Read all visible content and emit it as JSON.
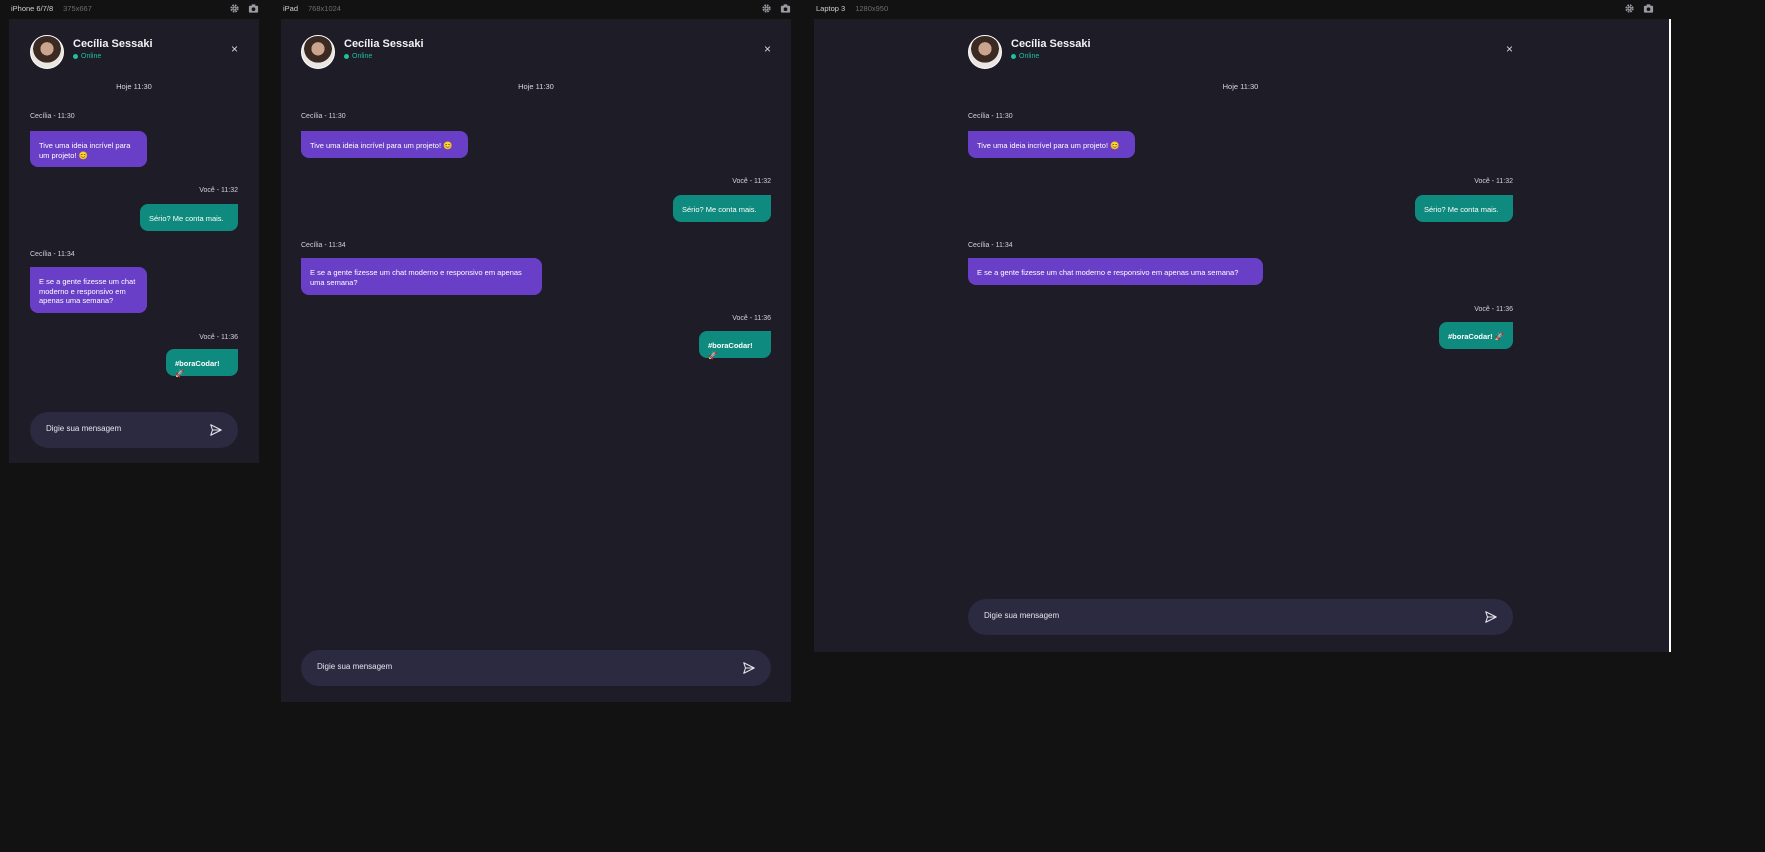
{
  "devices": {
    "iphone": {
      "name": "iPhone 6/7/8",
      "size": "375x667"
    },
    "ipad": {
      "name": "iPad",
      "size": "768x1024"
    },
    "laptop": {
      "name": "Laptop 3",
      "size": "1280x950"
    }
  },
  "icons": {
    "settings": "gear-icon",
    "screenshot": "camera-icon",
    "close": "close-icon",
    "send": "send-icon"
  },
  "colors": {
    "background": "#121212",
    "surface": "#1d1c27",
    "incoming": "#6a3fc7",
    "outgoing": "#0f8a7e",
    "online": "#1fbf9f",
    "composer": "#2b2a40"
  },
  "chat": {
    "contact_name": "Cecília Sessaki",
    "status": "Online",
    "close_glyph": "×",
    "day_label": "Hoje 11:30",
    "messages": [
      {
        "from": "contact",
        "meta": "Cecília - 11:30",
        "text": "Tive uma ideia incrível para um projeto! 😊"
      },
      {
        "from": "me",
        "meta": "Você - 11:32",
        "text": "Sério? Me conta mais."
      },
      {
        "from": "contact",
        "meta": "Cecília - 11:34",
        "text": "E se a gente fizesse um chat moderno e responsivo em apenas uma semana?"
      },
      {
        "from": "me",
        "meta": "Você - 11:36",
        "text": "#boraCodar! 🚀"
      }
    ],
    "input_placeholder": "Digie sua mensagem"
  }
}
